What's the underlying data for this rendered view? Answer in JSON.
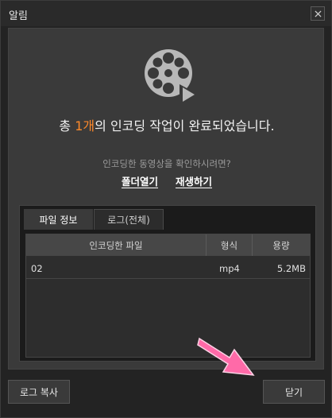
{
  "window": {
    "title": "알림"
  },
  "message": {
    "prefix": "총 ",
    "count": "1개",
    "suffix": "의 인코딩 작업이 완료되었습니다."
  },
  "question": "인코딩한 동영상을 확인하시려면?",
  "links": {
    "open_folder": "폴더열기",
    "play": "재생하기"
  },
  "tabs": [
    {
      "label": "파일 정보",
      "active": true
    },
    {
      "label": "로그(전체)",
      "active": false
    }
  ],
  "table": {
    "headers": [
      "인코딩한 파일",
      "형식",
      "용량"
    ],
    "rows": [
      {
        "file": "02",
        "format": "mp4",
        "size": "5.2MB"
      }
    ]
  },
  "buttons": {
    "copy_log": "로그 복사",
    "close": "닫기"
  },
  "colors": {
    "accent": "#ff8a2a",
    "arrow": "#ff6aa8"
  },
  "icons": [
    "close-icon",
    "film-reel-play-icon",
    "pointer-arrow-icon"
  ]
}
